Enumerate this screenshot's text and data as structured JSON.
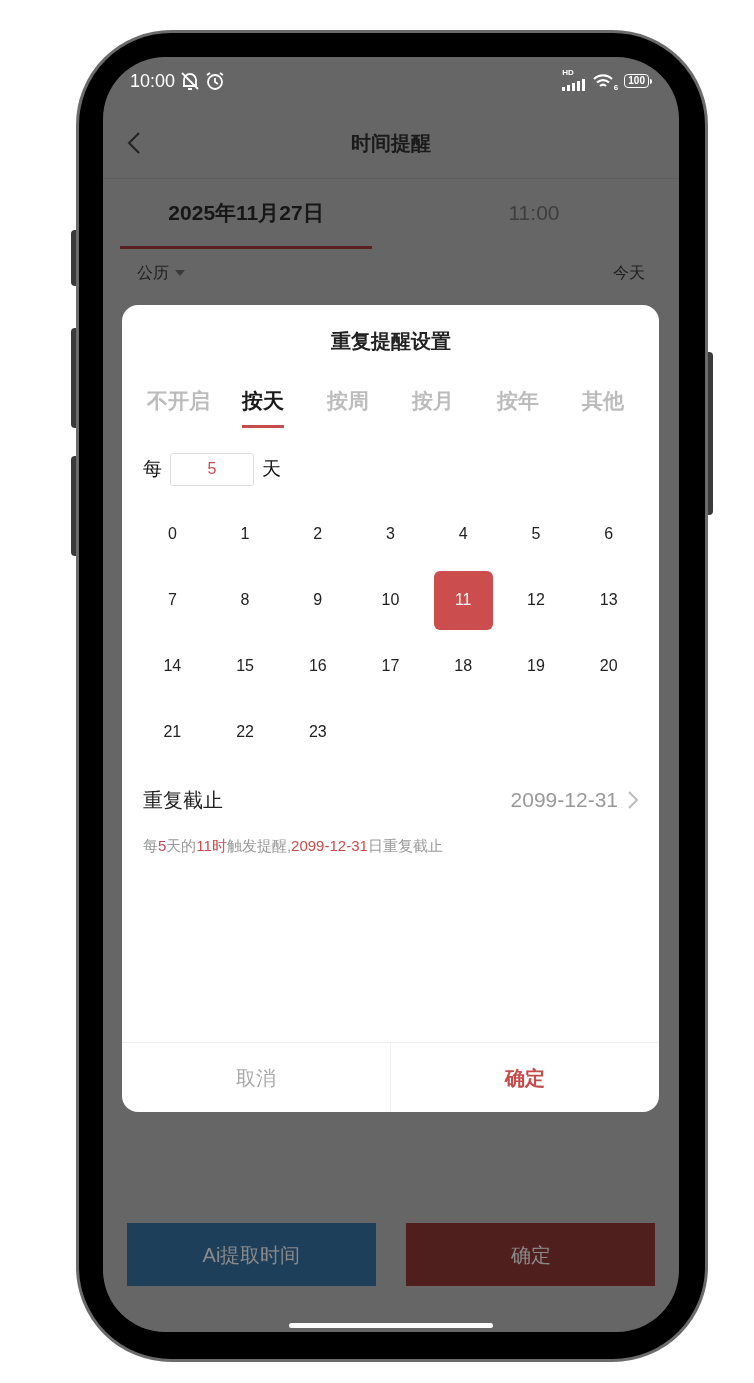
{
  "status_bar": {
    "time": "10:00",
    "signal_label": "HD",
    "wifi_label": "6",
    "battery": "100"
  },
  "header": {
    "title": "时间提醒"
  },
  "date_tabs": [
    {
      "label": "2025年11月27日",
      "selected": true
    },
    {
      "label": "11:00",
      "selected": false
    }
  ],
  "calendar_row": {
    "calendar_type": "公历",
    "today": "今天"
  },
  "dialog": {
    "title": "重复提醒设置",
    "tabs": [
      {
        "label": "不开启",
        "selected": false
      },
      {
        "label": "按天",
        "selected": true
      },
      {
        "label": "按周",
        "selected": false
      },
      {
        "label": "按月",
        "selected": false
      },
      {
        "label": "按年",
        "selected": false
      },
      {
        "label": "其他",
        "selected": false
      }
    ],
    "interval": {
      "prefix": "每",
      "value": "5",
      "suffix": "天"
    },
    "hours": [
      {
        "label": "0",
        "selected": false
      },
      {
        "label": "1",
        "selected": false
      },
      {
        "label": "2",
        "selected": false
      },
      {
        "label": "3",
        "selected": false
      },
      {
        "label": "4",
        "selected": false
      },
      {
        "label": "5",
        "selected": false
      },
      {
        "label": "6",
        "selected": false
      },
      {
        "label": "7",
        "selected": false
      },
      {
        "label": "8",
        "selected": false
      },
      {
        "label": "9",
        "selected": false
      },
      {
        "label": "10",
        "selected": false
      },
      {
        "label": "11",
        "selected": true
      },
      {
        "label": "12",
        "selected": false
      },
      {
        "label": "13",
        "selected": false
      },
      {
        "label": "14",
        "selected": false
      },
      {
        "label": "15",
        "selected": false
      },
      {
        "label": "16",
        "selected": false
      },
      {
        "label": "17",
        "selected": false
      },
      {
        "label": "18",
        "selected": false
      },
      {
        "label": "19",
        "selected": false
      },
      {
        "label": "20",
        "selected": false
      },
      {
        "label": "21",
        "selected": false
      },
      {
        "label": "22",
        "selected": false
      },
      {
        "label": "23",
        "selected": false
      }
    ],
    "end": {
      "label": "重复截止",
      "value": "2099-12-31"
    },
    "summary": [
      {
        "text": "每",
        "highlight": false
      },
      {
        "text": "5",
        "highlight": true
      },
      {
        "text": "天的",
        "highlight": false
      },
      {
        "text": "11时",
        "highlight": true
      },
      {
        "text": "触发提醒,",
        "highlight": false
      },
      {
        "text": "2099-12-31",
        "highlight": true
      },
      {
        "text": "日重复截止",
        "highlight": false
      }
    ],
    "buttons": [
      {
        "label": "取消",
        "kind": "cancel"
      },
      {
        "label": "确定",
        "kind": "confirm"
      }
    ]
  },
  "bottom_buttons": [
    {
      "label": "Ai提取时间",
      "kind": "ai"
    },
    {
      "label": "确定",
      "kind": "confirm"
    }
  ]
}
